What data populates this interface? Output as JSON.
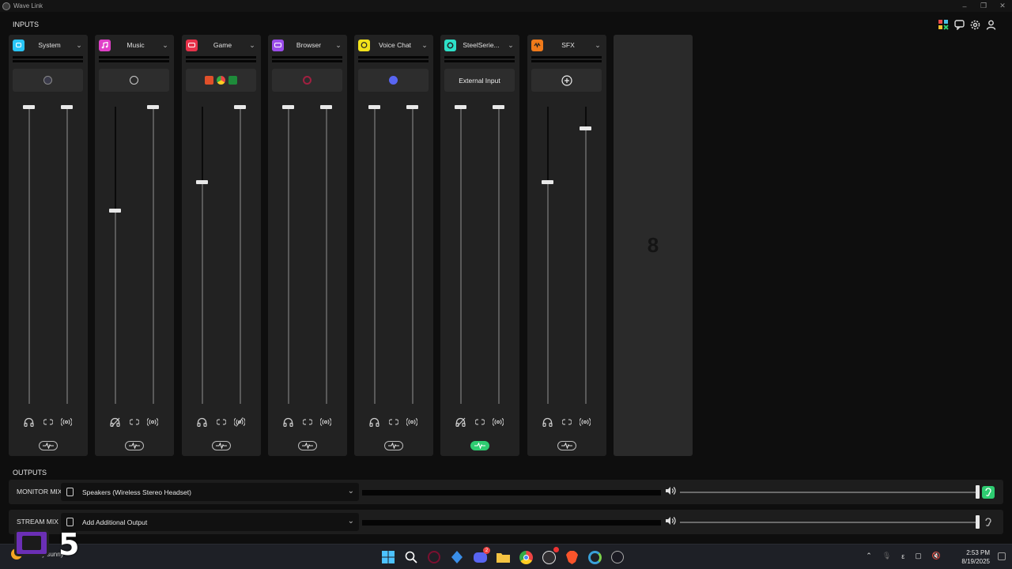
{
  "window": {
    "title": "Wave Link"
  },
  "sections": {
    "inputs": "INPUTS",
    "outputs": "OUTPUTS"
  },
  "channels": [
    {
      "name": "System",
      "color": "#29c5f6",
      "source_text": "",
      "left_level": 1.0,
      "right_level": 1.0,
      "monitor_muted": false,
      "stream_muted": false,
      "effects_on": false
    },
    {
      "name": "Music",
      "color": "#e040c8",
      "source_text": "",
      "left_level": 0.65,
      "right_level": 1.0,
      "monitor_muted": true,
      "stream_muted": false,
      "effects_on": false
    },
    {
      "name": "Game",
      "color": "#e8324a",
      "source_text": "",
      "left_level": 0.75,
      "right_level": 1.0,
      "monitor_muted": false,
      "stream_muted": true,
      "effects_on": false
    },
    {
      "name": "Browser",
      "color": "#9b4dea",
      "source_text": "",
      "left_level": 1.0,
      "right_level": 1.0,
      "monitor_muted": false,
      "stream_muted": false,
      "effects_on": false
    },
    {
      "name": "Voice Chat",
      "color": "#f2e21b",
      "source_text": "",
      "left_level": 1.0,
      "right_level": 1.0,
      "monitor_muted": false,
      "stream_muted": false,
      "effects_on": false
    },
    {
      "name": "SteelSerie...",
      "color": "#2de0c8",
      "source_text": "External Input",
      "left_level": 1.0,
      "right_level": 1.0,
      "monitor_muted": true,
      "stream_muted": false,
      "effects_on": true
    },
    {
      "name": "SFX",
      "color": "#f07a1a",
      "source_text": "",
      "left_level": 0.75,
      "right_level": 0.93,
      "monitor_muted": false,
      "stream_muted": false,
      "effects_on": false
    }
  ],
  "empty_slot": {
    "label": "8"
  },
  "outputs": [
    {
      "label": "MONITOR MIX",
      "device": "Speakers (Wireless Stereo Headset)",
      "level": 1.0,
      "listening": true
    },
    {
      "label": "STREAM MIX",
      "device": "Add Additional Output",
      "level": 1.0,
      "listening": false
    }
  ],
  "taskbar": {
    "weather_temp": "",
    "weather_desc": "Mostly sunny",
    "time": "2:53 PM",
    "date": "8/19/2025",
    "discord_badge": "2",
    "overlay_number": "5"
  },
  "colors": {
    "accent_green": "#2ecc71",
    "panel": "#222222",
    "background": "#0e0e0e"
  }
}
